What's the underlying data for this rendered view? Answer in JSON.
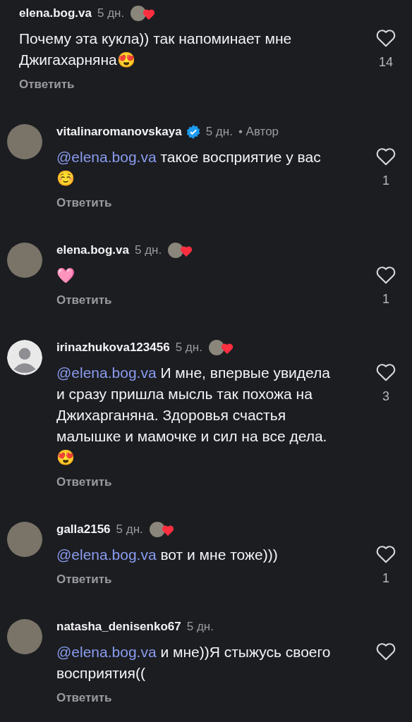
{
  "comments": [
    {
      "username": "elena.bog.va",
      "verified": false,
      "time": "5 дн.",
      "author_liked": true,
      "text": "Почему эта кукла)) так напоминает мне Джигахарняна😍",
      "likes": "14",
      "reply": "Ответить"
    },
    {
      "avatar": {
        "kind": "photo"
      },
      "username": "vitalinaromanovskaya",
      "verified": true,
      "time": "5 дн.",
      "author_label": "• Автор",
      "author_liked": false,
      "mention": "@elena.bog.va",
      "text": "такое восприятие у вас☺️",
      "likes": "1",
      "reply": "Ответить"
    },
    {
      "avatar": {
        "kind": "photo"
      },
      "username": "elena.bog.va",
      "verified": false,
      "time": "5 дн.",
      "author_liked": true,
      "text": "🩷",
      "likes": "1",
      "reply": "Ответить"
    },
    {
      "avatar": {
        "kind": "default"
      },
      "username": "irinazhukova123456",
      "verified": false,
      "time": "5 дн.",
      "author_liked": true,
      "mention": "@elena.bog.va",
      "text": "И мне, впервые увидела и сразу пришла мысль так похожа на Джихарганяна. Здоровья счастья малышке и мамочке и сил на все дела.😍",
      "likes": "3",
      "reply": "Ответить"
    },
    {
      "avatar": {
        "kind": "photo"
      },
      "username": "galla2156",
      "verified": false,
      "time": "5 дн.",
      "author_liked": true,
      "mention": "@elena.bog.va",
      "text": "вот и мне тоже)))",
      "likes": "1",
      "reply": "Ответить"
    },
    {
      "avatar": {
        "kind": "photo"
      },
      "username": "natasha_denisenko67",
      "verified": false,
      "time": "5 дн.",
      "author_liked": false,
      "mention": "@elena.bog.va",
      "text": "и мне))Я стыжусь своего восприятия((",
      "reply": "Ответить"
    }
  ]
}
